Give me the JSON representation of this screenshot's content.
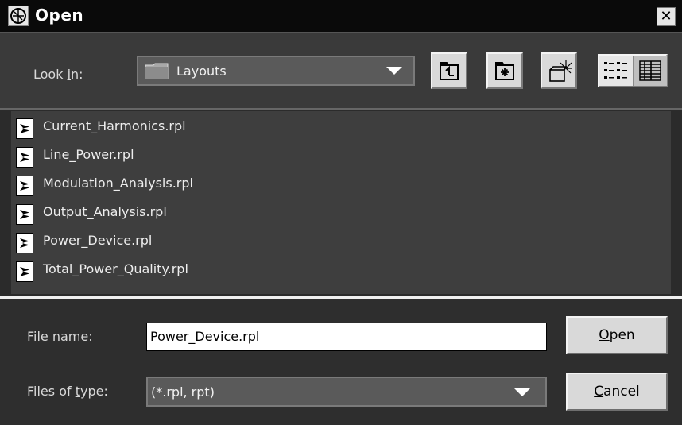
{
  "window": {
    "title": "Open",
    "close_glyph": "✕"
  },
  "look_in": {
    "label_pre": "Look ",
    "label_mnemonic": "i",
    "label_post": "n:",
    "value": "Layouts"
  },
  "toolbar": {
    "up_folder_icon": "up-one-level-icon",
    "home_icon": "home-folder-icon",
    "new_folder_icon": "new-folder-icon",
    "list_view_icon": "list-view-icon",
    "details_view_icon": "details-view-icon"
  },
  "files": [
    "Current_Harmonics.rpl",
    "Line_Power.rpl",
    "Modulation_Analysis.rpl",
    "Output_Analysis.rpl",
    "Power_Device.rpl",
    "Total_Power_Quality.rpl"
  ],
  "file_name": {
    "label_pre": "File ",
    "label_mnemonic": "n",
    "label_post": "ame:",
    "value": "Power_Device.rpl"
  },
  "file_type": {
    "label_pre": "Files of ",
    "label_mnemonic": "t",
    "label_post": "ype:",
    "value": "(*.rpl, rpt)"
  },
  "buttons": {
    "open_mnemonic": "O",
    "open_rest": "pen",
    "cancel_mnemonic": "C",
    "cancel_rest": "ancel"
  }
}
